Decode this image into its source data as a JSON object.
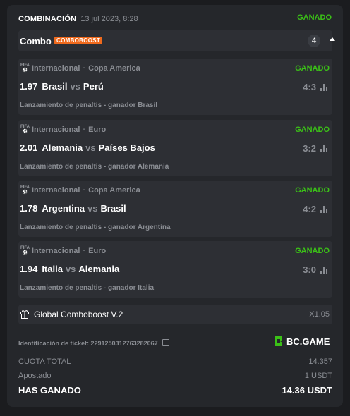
{
  "header": {
    "title": "COMBINACIÓN",
    "date": "13 jul 2023, 8:28",
    "status": "GANADO"
  },
  "combo": {
    "label": "Combo",
    "badge": "COMBOBOOST",
    "count": "4"
  },
  "bets": [
    {
      "sport_icon": "fifa-icon",
      "category": "Internacional",
      "league": "Copa America",
      "status": "GANADO",
      "odds": "1.97",
      "team1": "Brasil",
      "vs": "vs",
      "team2": "Perú",
      "score": "4:3",
      "description": "Lanzamiento de penaltis - ganador Brasil"
    },
    {
      "sport_icon": "fifa-icon",
      "category": "Internacional",
      "league": "Euro",
      "status": "GANADO",
      "odds": "2.01",
      "team1": "Alemania",
      "vs": "vs",
      "team2": "Países Bajos",
      "score": "3:2",
      "description": "Lanzamiento de penaltis - ganador Alemania"
    },
    {
      "sport_icon": "fifa-icon",
      "category": "Internacional",
      "league": "Copa America",
      "status": "GANADO",
      "odds": "1.78",
      "team1": "Argentina",
      "vs": "vs",
      "team2": "Brasil",
      "score": "4:2",
      "description": "Lanzamiento de penaltis - ganador Argentina"
    },
    {
      "sport_icon": "fifa-icon",
      "category": "Internacional",
      "league": "Euro",
      "status": "GANADO",
      "odds": "1.94",
      "team1": "Italia",
      "vs": "vs",
      "team2": "Alemania",
      "score": "3:0",
      "description": "Lanzamiento de penaltis - ganador Italia"
    }
  ],
  "boost": {
    "label": "Global Comboboost V.2",
    "multiplier": "X1.05"
  },
  "ticket": {
    "label": "Identificación de ticket: 2291250312763282067"
  },
  "brand": {
    "name": "BC.GAME"
  },
  "summary": {
    "odds_label": "CUOTA TOTAL",
    "odds_value": "14.357",
    "stake_label": "Apostado",
    "stake_value": "1 USDT",
    "win_label": "HAS GANADO",
    "win_value": "14.36 USDT"
  },
  "colors": {
    "won": "#3bc117",
    "badge": "#f06a1d",
    "brand_green": "#3bc117"
  }
}
